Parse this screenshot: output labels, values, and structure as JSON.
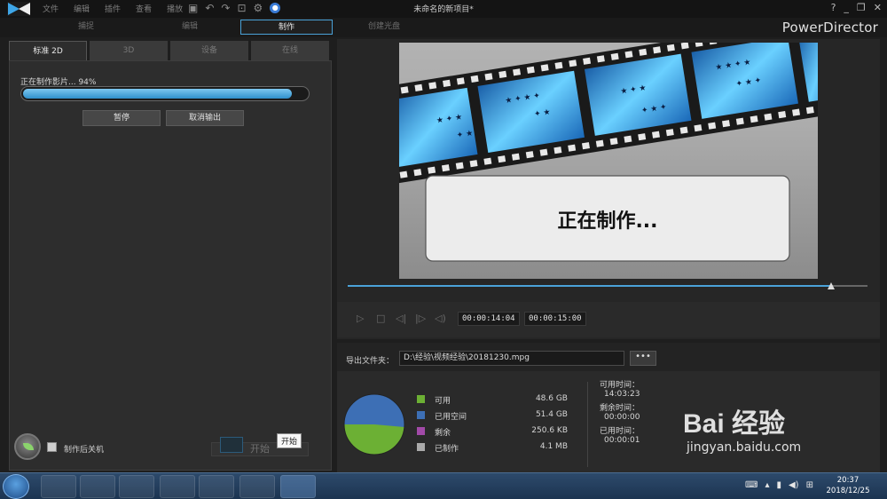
{
  "window": {
    "title": "未命名的新项目*",
    "brand": "PowerDirector",
    "menu": [
      "文件",
      "编辑",
      "插件",
      "查看",
      "播放"
    ],
    "controls": [
      "?",
      "_",
      "❐",
      "✕"
    ]
  },
  "modes": [
    {
      "label": "捕捉",
      "active": false
    },
    {
      "label": "编辑",
      "active": false
    },
    {
      "label": "制作",
      "active": true
    },
    {
      "label": "创建光盘",
      "active": false
    }
  ],
  "produce": {
    "sub_tabs": [
      {
        "label": "标准 2D",
        "active": true
      },
      {
        "label": "3D",
        "active": false
      },
      {
        "label": "设备",
        "active": false
      },
      {
        "label": "在线",
        "active": false
      }
    ],
    "progress_text": "正在制作影片... 94%",
    "progress_fraction": 0.94,
    "pause_label": "暂停",
    "cancel_label": "取消输出",
    "shutdown_label": "制作后关机",
    "start_label": "开始",
    "tooltip": "开始"
  },
  "preview": {
    "overlay_text": "正在制作...",
    "timeline_fraction": 0.93,
    "current_time": "00:00:14:04",
    "total_time": "00:00:15:00"
  },
  "export": {
    "folder_label": "导出文件夹：",
    "folder_path": "D:\\经验\\视频经验\\20181230.mpg",
    "browse_label": "•••",
    "legend": [
      {
        "name": "可用",
        "value": "48.6  GB",
        "color": "#6cb034"
      },
      {
        "name": "已用空间",
        "value": "51.4  GB",
        "color": "#3d6fb5"
      },
      {
        "name": "剩余",
        "value": "250.6  KB",
        "color": "#a24aa8"
      },
      {
        "name": "已制作",
        "value": "4.1  MB",
        "color": "#aaaaaa"
      }
    ],
    "pie_used_fraction": 0.514,
    "available_time_label": "可用时间：",
    "available_time": "14:03:23",
    "remaining_time_label": "剩余时间：",
    "remaining_time": "00:00:00",
    "elapsed_time_label": "已用时间：",
    "elapsed_time": "00:00:01"
  },
  "taskbar": {
    "time": "20:37",
    "date": "2018/12/25"
  },
  "watermark": {
    "brand": "Bai 经验",
    "url": "jingyan.baidu.com"
  }
}
